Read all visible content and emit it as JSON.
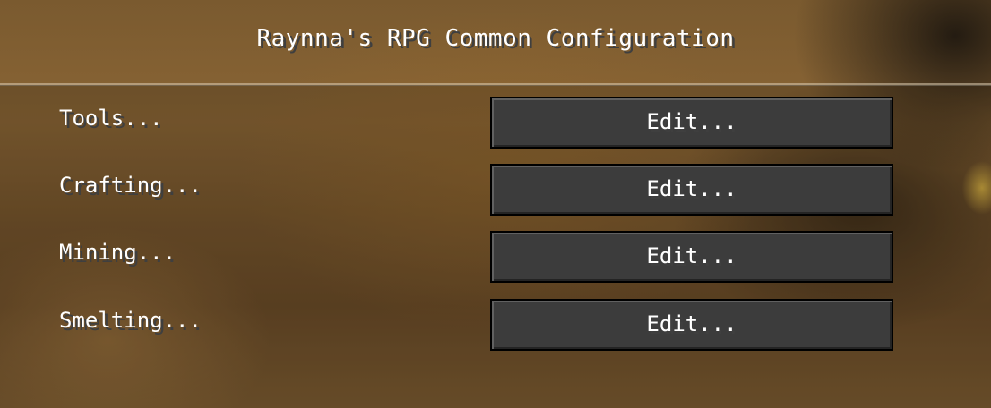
{
  "screen": {
    "title": "Raynna's RPG Common Configuration"
  },
  "rows": [
    {
      "label": "Tools...",
      "button_label": "Edit..."
    },
    {
      "label": "Crafting...",
      "button_label": "Edit..."
    },
    {
      "label": "Mining...",
      "button_label": "Edit..."
    },
    {
      "label": "Smelting...",
      "button_label": "Edit..."
    }
  ],
  "colors": {
    "text": "#ffffff",
    "text_shadow": "#3f3f3f",
    "button_fill": "#3c3c3c",
    "button_border": "#000000"
  }
}
